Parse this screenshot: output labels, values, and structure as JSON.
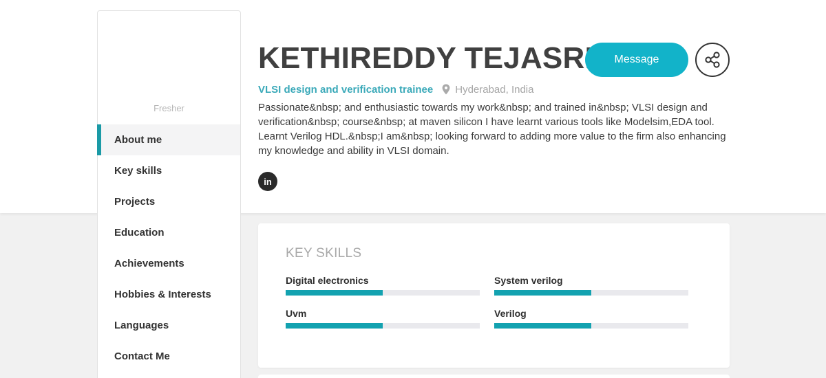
{
  "profile": {
    "status": "Fresher",
    "name": "KETHIREDDY TEJASRI",
    "role": "VLSI design and verification trainee",
    "location": "Hyderabad, India",
    "bio": "Passionate&nbsp; and enthusiastic towards my work&nbsp; and trained in&nbsp; VLSI design and verification&nbsp; course&nbsp; at maven silicon I have learnt various tools like Modelsim,EDA tool. Learnt Verilog HDL.&nbsp;I am&nbsp; looking forward to adding more value to the firm also enhancing my knowledge and ability in VLSI domain.",
    "social_label": "in"
  },
  "actions": {
    "message_label": "Message",
    "share_icon": "share-icon"
  },
  "sidebar": {
    "items": [
      {
        "label": "About me",
        "active": true
      },
      {
        "label": "Key skills",
        "active": false
      },
      {
        "label": "Projects",
        "active": false
      },
      {
        "label": "Education",
        "active": false
      },
      {
        "label": "Achievements",
        "active": false
      },
      {
        "label": "Hobbies & Interests",
        "active": false
      },
      {
        "label": "Languages",
        "active": false
      },
      {
        "label": "Contact Me",
        "active": false
      }
    ]
  },
  "skills": {
    "heading": "KEY SKILLS",
    "items": [
      {
        "label": "Digital electronics",
        "level": 0.5
      },
      {
        "label": "System verilog",
        "level": 0.5
      },
      {
        "label": "Uvm",
        "level": 0.5
      },
      {
        "label": "Verilog",
        "level": 0.5
      }
    ]
  },
  "colors": {
    "accent": "#12b3c9",
    "role_text": "#3aa9b9",
    "skill_fill": "#13a2b0",
    "skill_track": "#e9e9ed",
    "page_bg": "#f1f1f1"
  }
}
